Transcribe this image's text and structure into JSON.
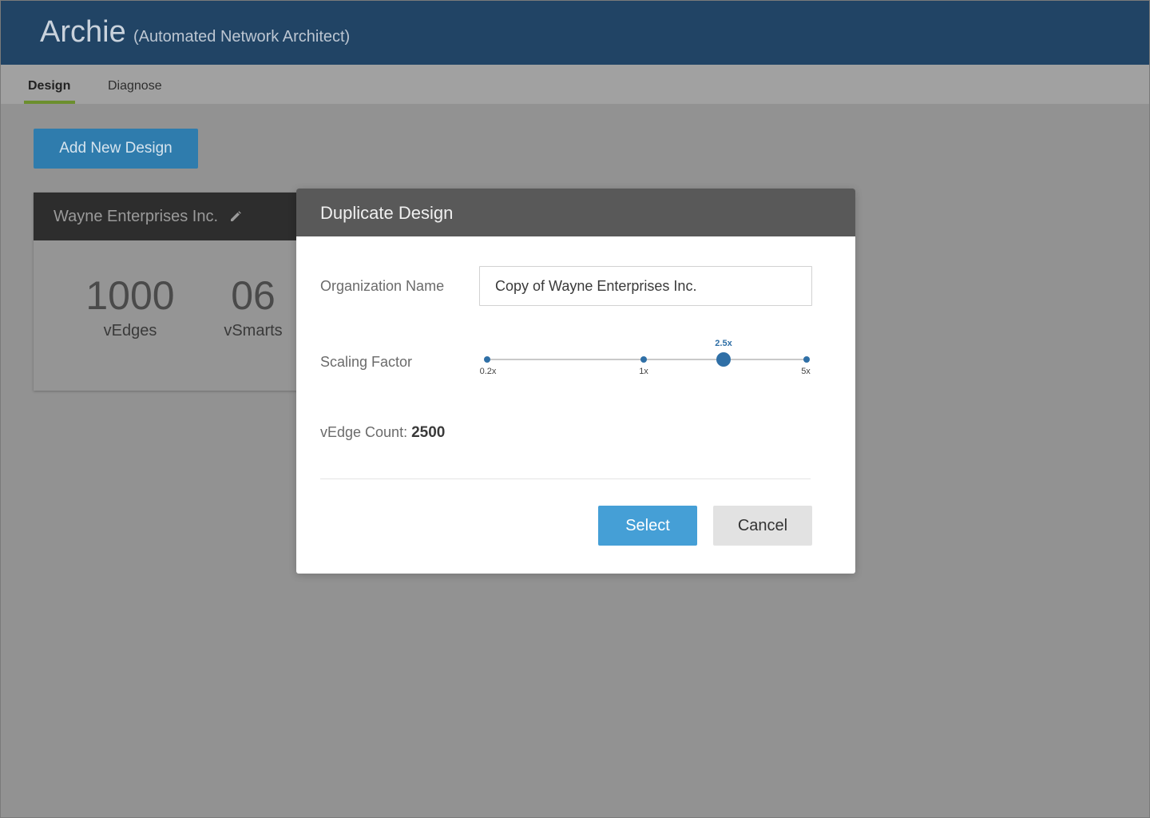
{
  "header": {
    "title": "Archie",
    "subtitle": "(Automated Network Architect)"
  },
  "tabs": [
    {
      "label": "Design",
      "active": true
    },
    {
      "label": "Diagnose",
      "active": false
    }
  ],
  "toolbar": {
    "add_label": "Add New Design"
  },
  "card": {
    "title": "Wayne Enterprises Inc.",
    "edit_icon": "pencil-icon",
    "stats": [
      {
        "value": "1000",
        "label": "vEdges"
      },
      {
        "value": "06",
        "label": "vSmarts"
      }
    ]
  },
  "modal": {
    "title": "Duplicate Design",
    "org_label": "Organization Name",
    "org_value": "Copy of Wayne Enterprises Inc.",
    "scaling_label": "Scaling Factor",
    "slider": {
      "ticks": [
        "0.2x",
        "1x",
        "5x"
      ],
      "selected": "2.5x"
    },
    "count_label": "vEdge Count:",
    "count_value": "2500",
    "select_label": "Select",
    "cancel_label": "Cancel"
  },
  "colors": {
    "header_bg": "#214465",
    "accent": "#459fd6",
    "slider": "#2f6fa6",
    "tab_underline": "#6c8f2e"
  }
}
